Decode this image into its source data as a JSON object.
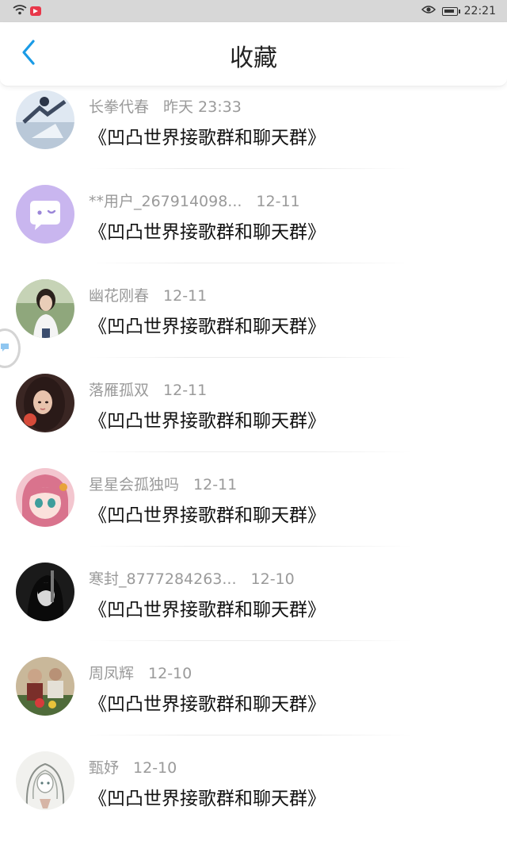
{
  "status_bar": {
    "time": "22:21",
    "icons": [
      "wifi-icon",
      "app-notification-icon",
      "eye-icon",
      "battery-icon"
    ]
  },
  "header": {
    "title": "收藏",
    "back_icon": "chevron-left-icon",
    "accent_color": "#1a9be6"
  },
  "favorites": [
    {
      "username": "长拳代春",
      "time": "昨天 23:33",
      "message": "《凹凸世界接歌群和聊天群》"
    },
    {
      "username": "**用户_267914098...",
      "time": "12-11",
      "message": "《凹凸世界接歌群和聊天群》"
    },
    {
      "username": "幽花刚春",
      "time": "12-11",
      "message": "《凹凸世界接歌群和聊天群》"
    },
    {
      "username": "落雁孤双",
      "time": "12-11",
      "message": "《凹凸世界接歌群和聊天群》"
    },
    {
      "username": "星星会孤独吗",
      "time": "12-11",
      "message": "《凹凸世界接歌群和聊天群》"
    },
    {
      "username": "寒封_8777284263...",
      "time": "12-10",
      "message": "《凹凸世界接歌群和聊天群》"
    },
    {
      "username": "周凤辉",
      "time": "12-10",
      "message": "《凹凸世界接歌群和聊天群》"
    },
    {
      "username": "甄妤",
      "time": "12-10",
      "message": "《凹凸世界接歌群和聊天群》"
    }
  ]
}
